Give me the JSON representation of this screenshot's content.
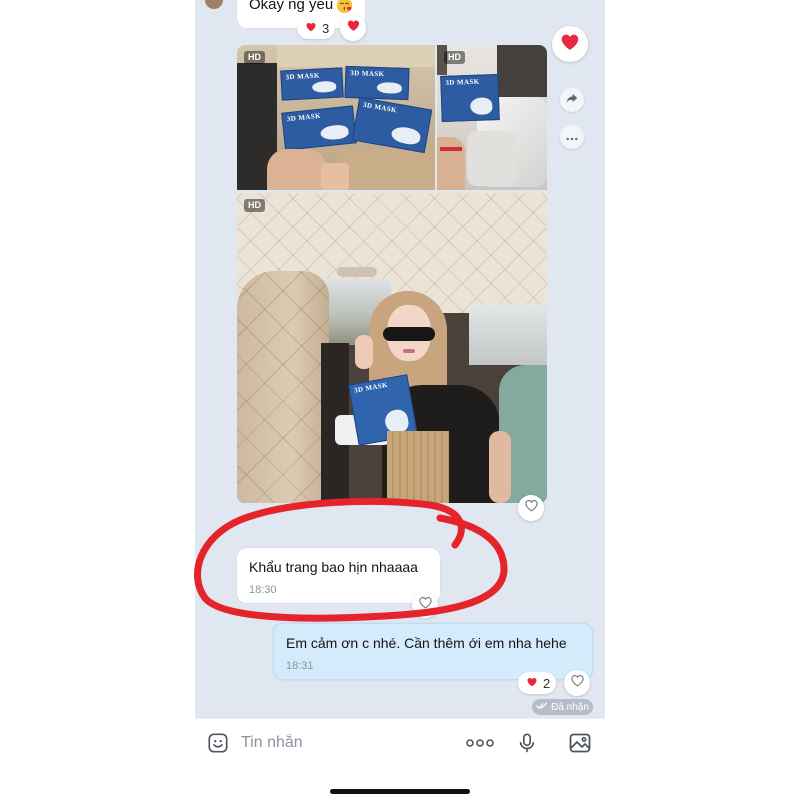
{
  "colors": {
    "chat_background": "#e0e7f0",
    "incoming_bubble": "#ffffff",
    "outgoing_bubble": "#d4ebfc",
    "reaction_heart": "#e8283e",
    "annotation": "#e5232b",
    "muted_text": "#8b949e"
  },
  "previous_message": {
    "text": "Okay ng yeu",
    "emoji_icon": "kiss-emoji-icon",
    "reaction_icon": "heart-icon",
    "reaction_count": "3",
    "react_icon": "heart-icon"
  },
  "photo_group": {
    "photos": [
      {
        "quality_badge": "HD",
        "box_label": "3D MASK"
      },
      {
        "quality_badge": "HD",
        "box_label": "3D MASK"
      },
      {
        "quality_badge": "HD",
        "box_label": "3D MASK"
      }
    ],
    "side_actions": [
      {
        "icon": "heart-icon"
      },
      {
        "icon": "share-icon"
      },
      {
        "icon": "more-icon"
      }
    ],
    "react_icon": "heart-outline-icon"
  },
  "incoming_message": {
    "text": "Khẩu trang bao hịn nhaaaa",
    "time": "18:30",
    "react_icon": "heart-outline-icon"
  },
  "outgoing_message": {
    "text": "Em cảm ơn c nhé. Cần thêm ới em nha hehe",
    "time": "18:31",
    "reaction_icon": "heart-icon",
    "reaction_count": "2",
    "react_icon": "heart-outline-icon",
    "status_icon": "double-check-icon",
    "delivery_status": "Đã nhận"
  },
  "input_bar": {
    "left_icon": "sticker-icon",
    "placeholder": "Tin nhắn",
    "right_icons": [
      "more-icon",
      "microphone-icon",
      "image-icon"
    ]
  }
}
